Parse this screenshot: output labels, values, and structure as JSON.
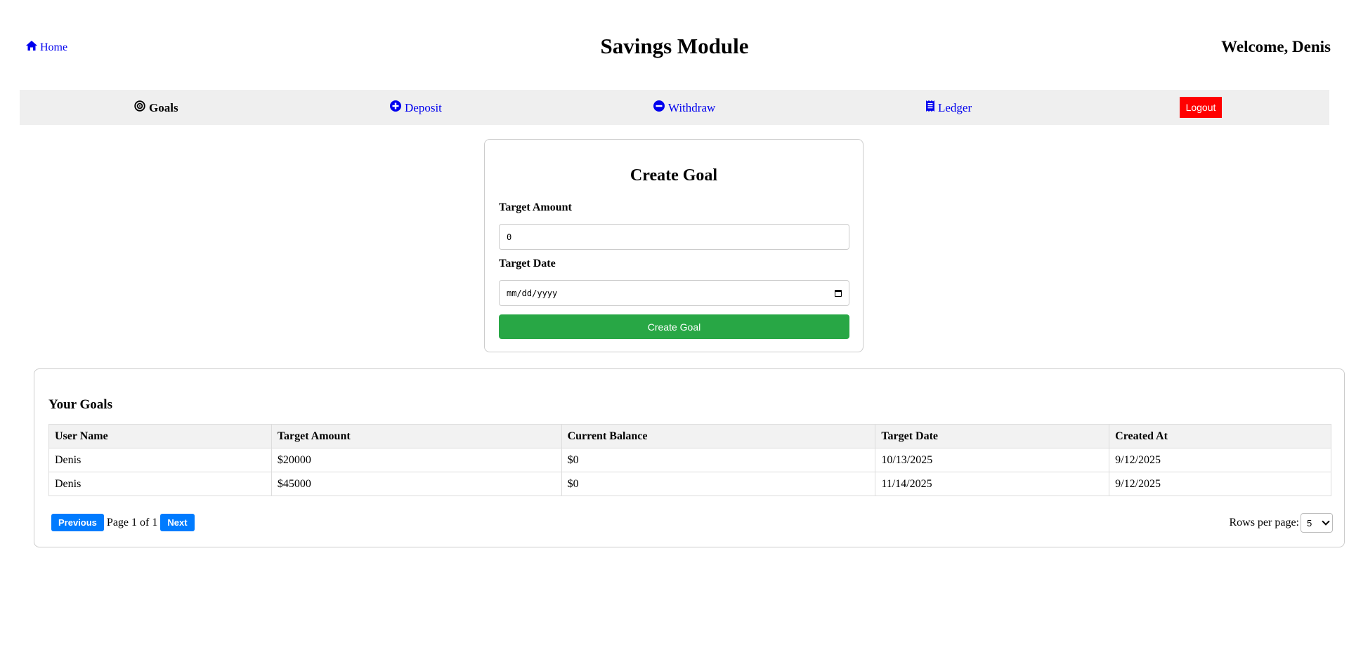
{
  "header": {
    "home_label": "Home",
    "title": "Savings Module",
    "welcome": "Welcome, Denis"
  },
  "nav": {
    "goals": "Goals",
    "deposit": "Deposit",
    "withdraw": "Withdraw",
    "ledger": "Ledger",
    "logout": "Logout"
  },
  "create_goal": {
    "title": "Create Goal",
    "target_amount_label": "Target Amount",
    "target_amount_value": "0",
    "target_date_label": "Target Date",
    "target_date_placeholder": "mm/dd/yyyy",
    "submit_label": "Create Goal"
  },
  "goals": {
    "title": "Your Goals",
    "columns": [
      "User Name",
      "Target Amount",
      "Current Balance",
      "Target Date",
      "Created At"
    ],
    "rows": [
      [
        "Denis",
        "$20000",
        "$0",
        "10/13/2025",
        "9/12/2025"
      ],
      [
        "Denis",
        "$45000",
        "$0",
        "11/14/2025",
        "9/12/2025"
      ]
    ]
  },
  "pagination": {
    "previous": "Previous",
    "page_info": "Page 1 of 1",
    "next": "Next",
    "rows_per_page_label": "Rows per page:",
    "rows_per_page_value": "5"
  },
  "colors": {
    "link": "#0000ee",
    "logout_bg": "#ff0000",
    "create_button_bg": "#28a745",
    "pager_button_bg": "#007bff",
    "navbar_bg": "#efefef"
  },
  "icons": {
    "home": "home-icon",
    "goals": "target-icon",
    "deposit": "plus-circle-icon",
    "withdraw": "minus-circle-icon",
    "ledger": "receipt-icon",
    "calendar": "calendar-icon",
    "rows_select": "chevron-down-icon"
  }
}
